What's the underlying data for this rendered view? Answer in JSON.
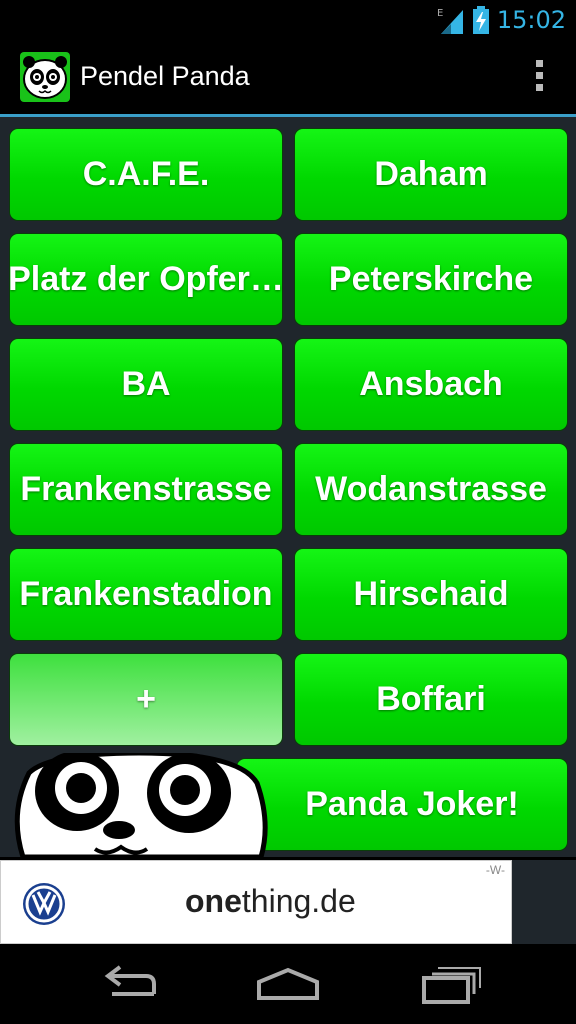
{
  "status_bar": {
    "network_type": "E",
    "time": "15:02",
    "signal_icon": "signal-icon",
    "battery_icon": "battery-charging-icon"
  },
  "action_bar": {
    "title": "Pendel Panda",
    "app_icon": "panda-app-icon",
    "menu_icon": "overflow-menu-icon"
  },
  "buttons": [
    {
      "label": "C.A.F.E."
    },
    {
      "label": "Daham"
    },
    {
      "label": "Platz der Opfer…"
    },
    {
      "label": "Peterskirche"
    },
    {
      "label": "BA"
    },
    {
      "label": "Ansbach"
    },
    {
      "label": "Frankenstrasse"
    },
    {
      "label": "Wodanstrasse"
    },
    {
      "label": "Frankenstadion"
    },
    {
      "label": "Hirschaid"
    },
    {
      "label": "+"
    },
    {
      "label": "Boffari"
    }
  ],
  "joker": {
    "label": "Panda Joker!"
  },
  "ad": {
    "text_bold": "one",
    "text_rest": "thing.de",
    "mark": "-W-",
    "logo_icon": "vw-logo-icon"
  },
  "nav": {
    "back_icon": "back-icon",
    "home_icon": "home-icon",
    "recents_icon": "recents-icon"
  },
  "colors": {
    "button_green": "#00d800",
    "accent_blue": "#35b5e5",
    "content_bg": "#1f262c"
  }
}
